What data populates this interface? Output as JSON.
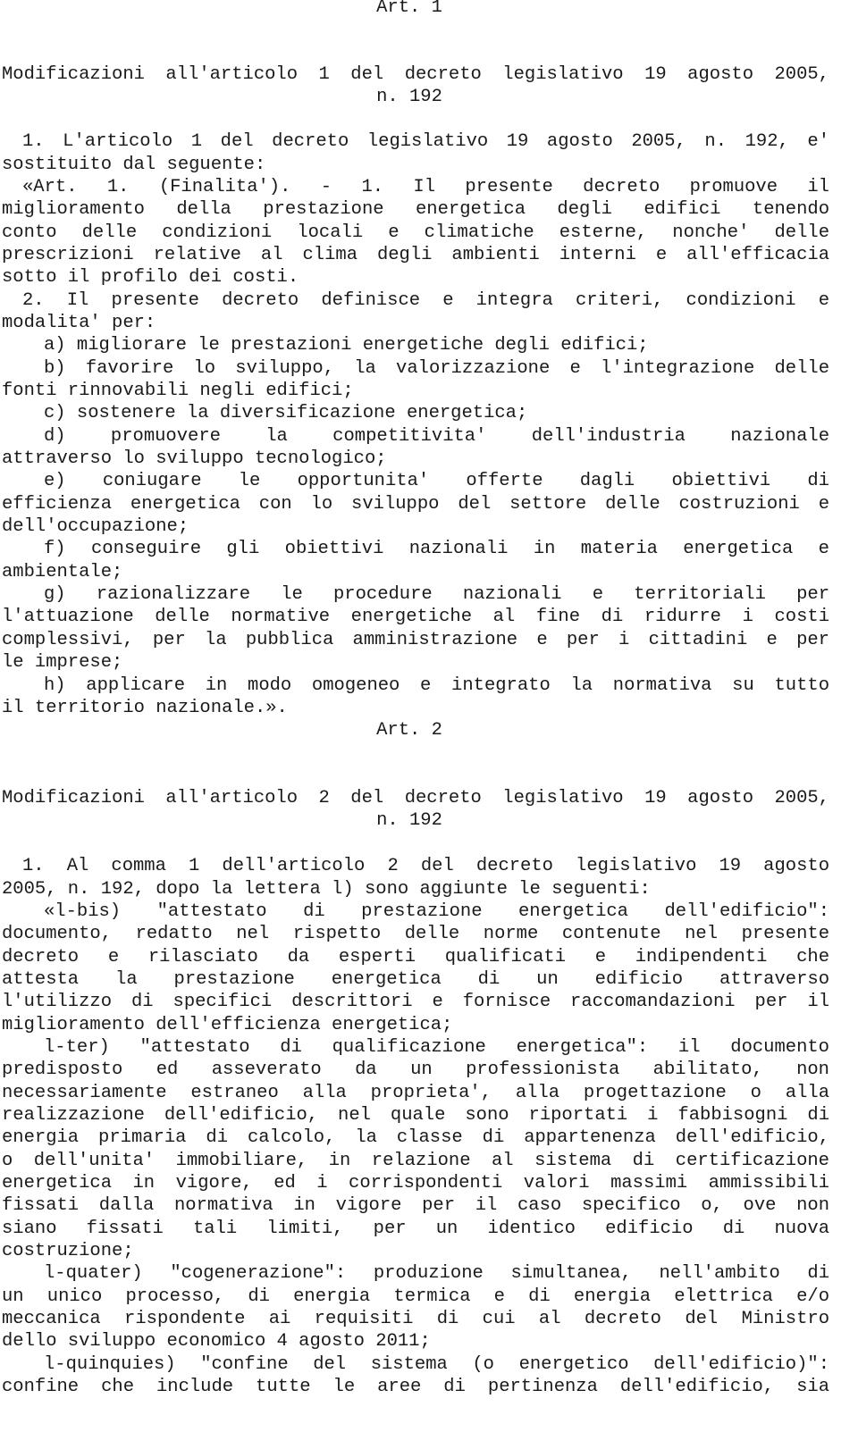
{
  "document": {
    "article1": {
      "title": "Art. 1",
      "heading_line1": "Modificazioni all'articolo 1 del decreto legislativo 19 agosto  2005,",
      "heading_line2": "n. 192",
      "lines": [
        "1. L'articolo 1 del decreto legislativo 19 agosto 2005, n. 192,  e'",
        "sostituito dal seguente:",
        "«Art.  1.  (Finalita').  -  1.  Il  presente  decreto  promuove  il",
        "miglioramento della  prestazione  energetica  degli  edifici  tenendo",
        "conto delle condizioni locali e  climatiche  esterne,  nonche'  delle",
        "prescrizioni relative al clima degli ambienti interni e all'efficacia",
        "sotto il profilo dei costi.",
        "2. Il presente decreto definisce e integra  criteri,  condizioni  e",
        "modalita' per:",
        "a) migliorare le prestazioni energetiche degli edifici;",
        "b) favorire lo sviluppo, la valorizzazione e l'integrazione delle",
        "fonti rinnovabili negli edifici;",
        "c) sostenere la diversificazione energetica;",
        "d)  promuovere  la  competitivita'  dell'industria  nazionale",
        "attraverso lo sviluppo tecnologico;",
        "e)  coniugare  le  opportunita'  offerte  dagli  obiettivi  di",
        "efficienza energetica con lo sviluppo del settore delle costruzioni e",
        "dell'occupazione;",
        "f) conseguire gli obiettivi nazionali  in  materia  energetica  e",
        "ambientale;",
        "g) razionalizzare  le  procedure  nazionali  e  territoriali  per",
        "l'attuazione delle normative energetiche al fine di ridurre  i  costi",
        "complessivi, per la pubblica amministrazione e per i cittadini e  per",
        "le imprese;",
        "h) applicare in modo omogeneo e integrato la normativa  su  tutto",
        "il territorio nazionale.»."
      ]
    },
    "article2": {
      "title": "Art. 2",
      "heading_line1": "Modificazioni all'articolo 2 del decreto legislativo 19 agosto  2005,",
      "heading_line2": "n. 192",
      "lines": [
        "1. Al comma 1 dell'articolo 2 del  decreto  legislativo  19  agosto",
        "2005, n. 192, dopo la lettera l) sono aggiunte le seguenti:",
        "«l-bis)  \"attestato  di  prestazione  energetica  dell'edificio\":",
        "documento, redatto nel rispetto delle norme  contenute  nel  presente",
        "decreto e  rilasciato  da  esperti  qualificati  e  indipendenti  che",
        "attesta  la  prestazione  energetica  di  un  edificio  attraverso",
        "l'utilizzo di specifici descrittori e fornisce raccomandazioni per il",
        "miglioramento dell'efficienza energetica;",
        "l-ter) \"attestato di  qualificazione  energetica\":  il  documento",
        "predisposto  ed  asseverato  da  un  professionista  abilitato,  non",
        "necessariamente estraneo alla proprieta', alla progettazione  o  alla",
        "realizzazione dell'edificio, nel quale sono riportati i fabbisogni di",
        "energia primaria di calcolo, la classe di appartenenza dell'edificio,",
        "o dell'unita' immobiliare, in relazione al sistema di  certificazione",
        "energetica in vigore, ed i corrispondenti valori massimi  ammissibili",
        "fissati dalla normativa in vigore per il caso specifico  o,  ove  non",
        "siano  fissati  tali  limiti,  per  un  identico  edificio  di  nuova",
        "costruzione;",
        "l-quater) \"cogenerazione\": produzione simultanea, nell'ambito  di",
        "un unico processo, di energia termica  e  di  energia  elettrica  e/o",
        "meccanica rispondente ai requisiti di cui  al  decreto  del  Ministro",
        "dello sviluppo economico 4 agosto 2011;",
        "l-quinquies) \"confine del sistema (o energetico  dell'edificio)\":",
        "confine che include tutte le aree di  pertinenza  dell'edificio,  sia"
      ]
    }
  }
}
